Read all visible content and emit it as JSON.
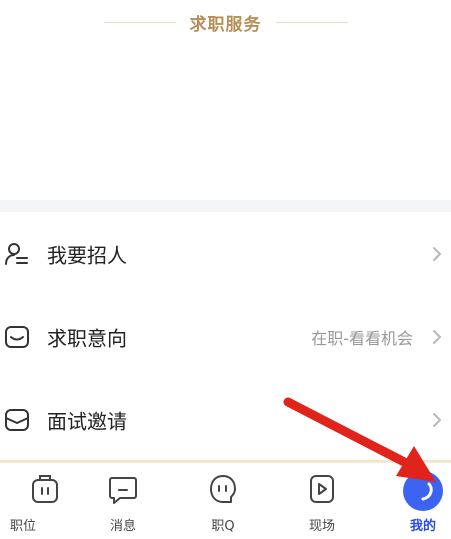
{
  "header": {
    "section_title": "求职服务"
  },
  "menu": {
    "items": [
      {
        "label": "我要招人",
        "value": "",
        "icon": "user-recruit-icon"
      },
      {
        "label": "求职意向",
        "value": "在职-看看机会",
        "icon": "job-intent-icon"
      },
      {
        "label": "面试邀请",
        "value": "",
        "icon": "interview-icon"
      }
    ]
  },
  "tabbar": {
    "tabs": [
      {
        "label": "职位",
        "icon": "briefcase-icon",
        "active": false
      },
      {
        "label": "消息",
        "icon": "message-icon",
        "active": false
      },
      {
        "label": "职Q",
        "icon": "qa-icon",
        "active": false
      },
      {
        "label": "现场",
        "icon": "video-icon",
        "active": false
      },
      {
        "label": "我的",
        "icon": "profile-icon",
        "active": true
      }
    ]
  },
  "colors": {
    "accent_gold": "#b58f59",
    "active_blue": "#2b4be0",
    "arrow_red": "#e0231b"
  }
}
